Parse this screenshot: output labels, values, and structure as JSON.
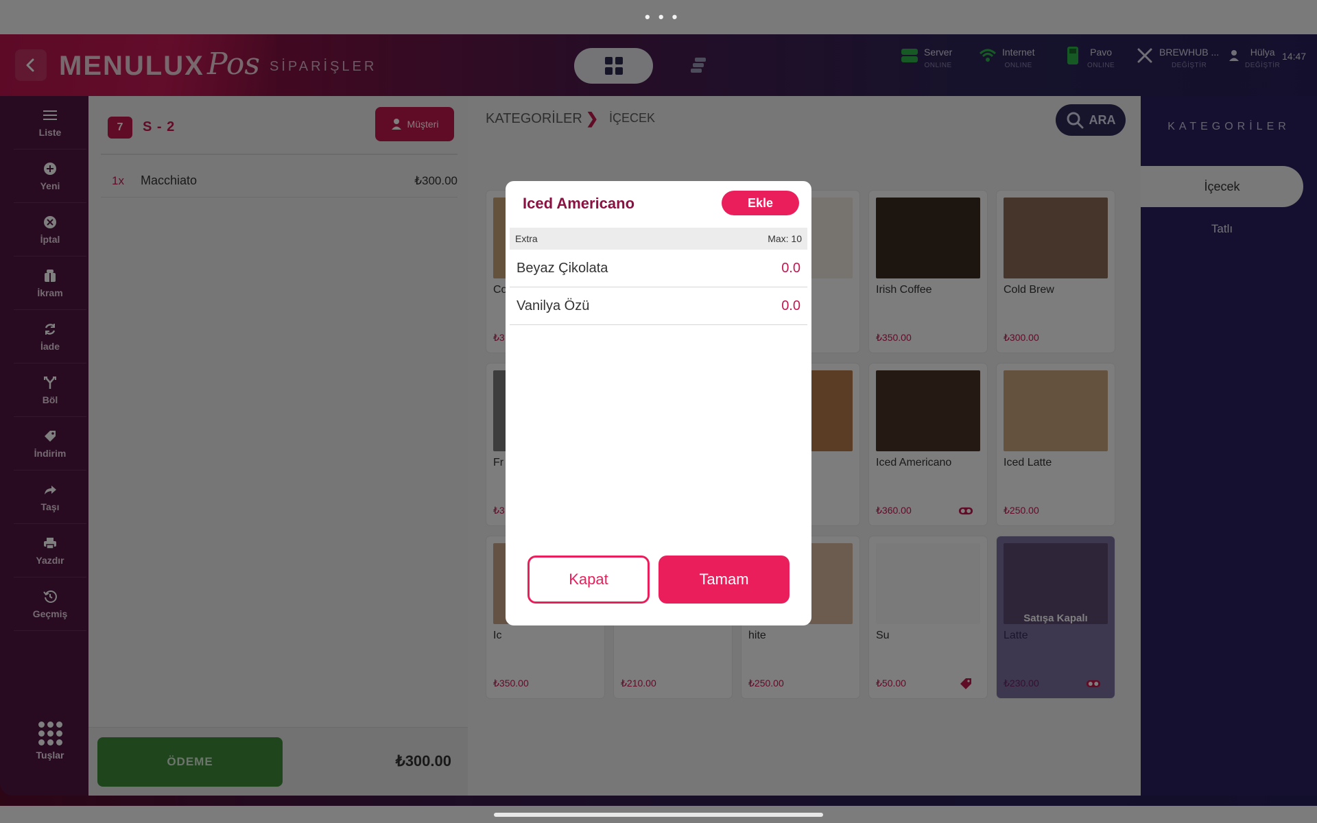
{
  "status_bar": {
    "dots": "• • •"
  },
  "header": {
    "brand": "MENULUX",
    "brand_pos": "Pos",
    "page_title": "SİPARİŞLER",
    "status": [
      {
        "label": "Server",
        "sub": "ONLINE",
        "icon": "server-icon"
      },
      {
        "label": "Internet",
        "sub": "ONLINE",
        "icon": "wifi-icon"
      },
      {
        "label": "Pavo",
        "sub": "ONLINE",
        "icon": "pos-terminal-icon"
      },
      {
        "label": "BREWHUB ...",
        "sub": "DEĞİŞTİR",
        "icon": "cutlery-icon"
      },
      {
        "label": "Hülya",
        "sub": "DEĞİŞTİR",
        "icon": "user-icon"
      }
    ],
    "time": "14:47"
  },
  "sidebar": {
    "items": [
      {
        "label": "Liste",
        "icon": "list-icon"
      },
      {
        "label": "Yeni",
        "icon": "plus-circle-icon"
      },
      {
        "label": "İptal",
        "icon": "cancel-circle-icon"
      },
      {
        "label": "İkram",
        "icon": "gift-icon"
      },
      {
        "label": "İade",
        "icon": "refund-icon"
      },
      {
        "label": "Böl",
        "icon": "split-icon"
      },
      {
        "label": "İndirim",
        "icon": "discount-tag-icon"
      },
      {
        "label": "Taşı",
        "icon": "move-arrow-icon"
      },
      {
        "label": "Yazdır",
        "icon": "printer-icon"
      },
      {
        "label": "Geçmiş",
        "icon": "history-icon"
      }
    ],
    "keypad_label": "Tuşlar"
  },
  "order": {
    "table_no": "7",
    "table_name": "S - 2",
    "customer_label": "Müşteri",
    "items": [
      {
        "qty": "1x",
        "name": "Macchiato",
        "price": "₺300.00"
      }
    ],
    "pay_label": "ÖDEME",
    "total": "₺300.00"
  },
  "breadcrumb": {
    "root": "KATEGORİLER",
    "current": "İÇECEK"
  },
  "search": {
    "label": "ARA"
  },
  "products": [
    {
      "name": "Co",
      "price": "₺3",
      "image_color": "#c9a47a"
    },
    {
      "name": "",
      "price": "",
      "image_color": "#5a3a2a"
    },
    {
      "name": "",
      "price": "",
      "image_color": "#efe7df"
    },
    {
      "name": "Irish Coffee",
      "price": "₺350.00",
      "image_color": "#3a2a20"
    },
    {
      "name": "Cold Brew",
      "price": "₺300.00",
      "image_color": "#8a6a54"
    },
    {
      "name": "Fr",
      "price": "₺3",
      "image_color": "#7a7a7a"
    },
    {
      "name": "",
      "price": "",
      "image_color": "#ddd"
    },
    {
      "name": "",
      "price": "",
      "image_color": "#b67a4a"
    },
    {
      "name": "Iced Americano",
      "price": "₺360.00",
      "image_color": "#4a3426",
      "tag": "toggle"
    },
    {
      "name": "Iced Latte",
      "price": "₺250.00",
      "image_color": "#c9a57f"
    },
    {
      "name": "Ic",
      "price": "₺350.00",
      "image_color": "#c8a58a"
    },
    {
      "name": "",
      "price": "₺210.00",
      "image_color": "#ddd"
    },
    {
      "name": "hite",
      "price": "₺250.00",
      "image_color": "#d8b8a0"
    },
    {
      "name": "Su",
      "price": "₺50.00",
      "image_color": "#f4f4f4",
      "tag": "discount"
    },
    {
      "name": "Latte",
      "price": "₺230.00",
      "image_color": "#a28a7a",
      "tag": "toggle",
      "soldout": "Satışa Kapalı"
    }
  ],
  "categories_panel": {
    "title": "KATEGORİLER",
    "items": [
      {
        "label": "İçecek",
        "active": true
      },
      {
        "label": "Tatlı",
        "active": false
      }
    ]
  },
  "modal": {
    "title": "Iced Americano",
    "add_label": "Ekle",
    "section": "Extra",
    "max": "Max: 10",
    "extras": [
      {
        "name": "Beyaz Çikolata",
        "value": "0.0"
      },
      {
        "name": "Vanilya Özü",
        "value": "0.0"
      }
    ],
    "close_label": "Kapat",
    "ok_label": "Tamam"
  },
  "colors": {
    "accent": "#e91e5a",
    "brand": "#c2184f",
    "pay": "#3e8a3a",
    "panel": "#2a2160"
  }
}
